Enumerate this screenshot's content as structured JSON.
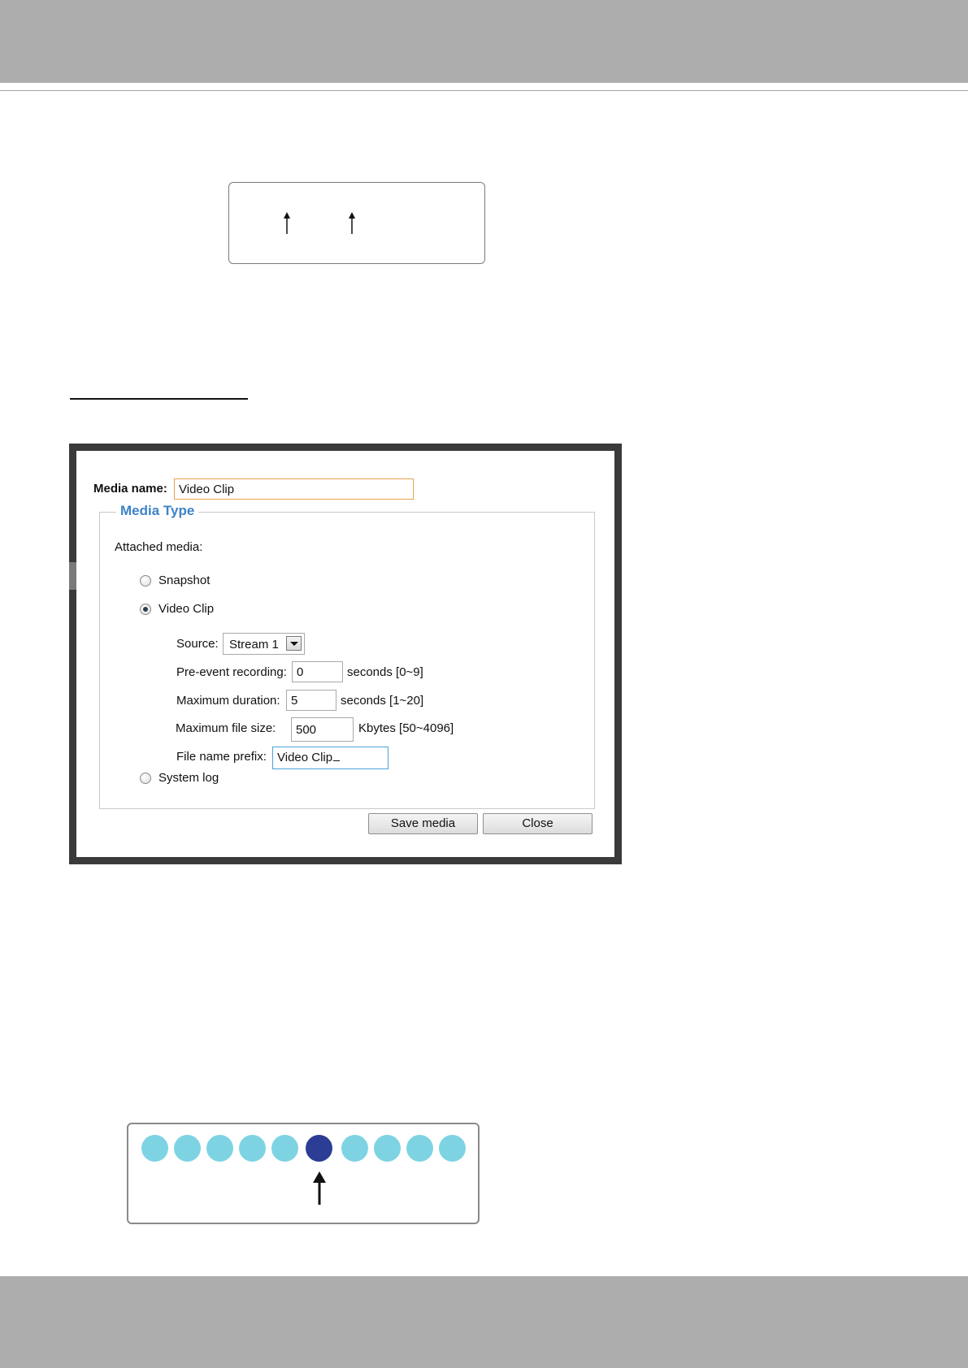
{
  "colors": {
    "band_gray": "#adadad",
    "legend_blue": "#3d83c7",
    "dot_light": "#7ed3e3",
    "dot_active": "#2b3d94"
  },
  "dialog": {
    "media_name_label": "Media name:",
    "media_name_value": "Video Clip",
    "section_title": "Media Type",
    "attached_media_label": "Attached media:",
    "options": {
      "snapshot": "Snapshot",
      "video_clip": "Video Clip",
      "system_log": "System log"
    },
    "selected_option": "Video Clip",
    "source_label": "Source:",
    "source_value": "Stream 1",
    "pre_event_label": "Pre-event recording:",
    "pre_event_value": "0",
    "pre_event_unit": "seconds [0~9]",
    "max_duration_label": "Maximum duration:",
    "max_duration_value": "5",
    "max_duration_unit": "seconds [1~20]",
    "max_file_size_label": "Maximum file size:",
    "max_file_size_value": "500",
    "max_file_size_unit": "Kbytes [50~4096]",
    "file_prefix_label": "File name prefix:",
    "file_prefix_value": "Video Clip",
    "save_button": "Save media",
    "close_button": "Close"
  },
  "dots_diagram": {
    "dot_count": 10,
    "active_index": 5
  }
}
